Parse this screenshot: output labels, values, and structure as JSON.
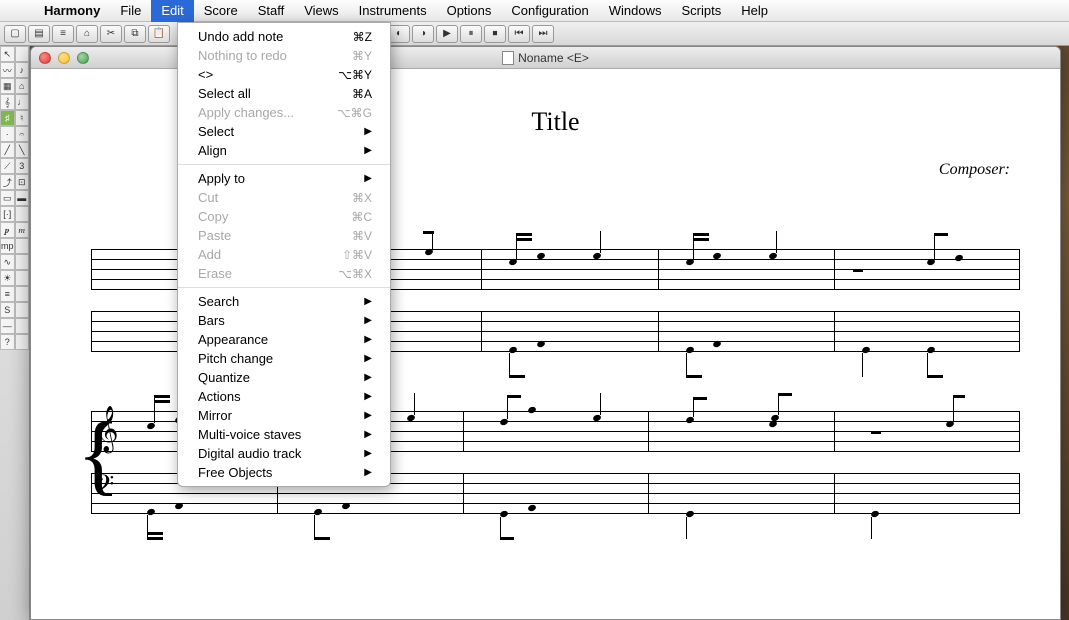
{
  "menubar": {
    "apple": "",
    "items": [
      {
        "label": "Harmony",
        "app": true
      },
      {
        "label": "File"
      },
      {
        "label": "Edit",
        "active": true
      },
      {
        "label": "Score"
      },
      {
        "label": "Staff"
      },
      {
        "label": "Views"
      },
      {
        "label": "Instruments"
      },
      {
        "label": "Options"
      },
      {
        "label": "Configuration"
      },
      {
        "label": "Windows"
      },
      {
        "label": "Scripts"
      },
      {
        "label": "Help"
      }
    ]
  },
  "edit_menu": [
    {
      "label": "Undo add note",
      "shortcut": "⌘Z"
    },
    {
      "label": "Nothing to redo",
      "shortcut": "⌘Y",
      "disabled": true
    },
    {
      "label": "<>",
      "shortcut": "⌥⌘Y"
    },
    {
      "label": "Select all",
      "shortcut": "⌘A"
    },
    {
      "label": "Apply changes...",
      "shortcut": "⌥⌘G",
      "disabled": true
    },
    {
      "label": "Select",
      "submenu": true
    },
    {
      "label": "Align",
      "submenu": true
    },
    {
      "sep": true
    },
    {
      "label": "Apply to",
      "submenu": true
    },
    {
      "label": "Cut",
      "shortcut": "⌘X",
      "disabled": true
    },
    {
      "label": "Copy",
      "shortcut": "⌘C",
      "disabled": true
    },
    {
      "label": "Paste",
      "shortcut": "⌘V",
      "disabled": true
    },
    {
      "label": "Add",
      "shortcut": "⇧⌘V",
      "disabled": true
    },
    {
      "label": "Erase",
      "shortcut": "⌥⌘X",
      "disabled": true
    },
    {
      "sep": true
    },
    {
      "label": "Search",
      "submenu": true
    },
    {
      "label": "Bars",
      "submenu": true
    },
    {
      "label": "Appearance",
      "submenu": true
    },
    {
      "label": "Pitch change",
      "submenu": true
    },
    {
      "label": "Quantize",
      "submenu": true
    },
    {
      "label": "Actions",
      "submenu": true
    },
    {
      "label": "Mirror",
      "submenu": true
    },
    {
      "label": "Multi-voice staves",
      "submenu": true
    },
    {
      "label": "Digital audio track",
      "submenu": true
    },
    {
      "label": "Free Objects",
      "submenu": true
    }
  ],
  "window": {
    "title": "Noname <E>"
  },
  "score": {
    "title": "Title",
    "composer_label": "Composer:"
  },
  "palette_tools": [
    [
      "↖",
      ""
    ],
    [
      "〰",
      "♪"
    ],
    [
      "▦",
      "⌂"
    ],
    [
      "𝄞",
      "♩"
    ],
    [
      "♯",
      "♮"
    ],
    [
      "·",
      "𝄐"
    ],
    [
      "╱",
      "╲"
    ],
    [
      "⟋",
      "3"
    ],
    [
      "⤴",
      "⊡"
    ],
    [
      "▭",
      "▬"
    ],
    [
      "[·]",
      ""
    ],
    [
      "𝆏",
      "𝆐"
    ],
    [
      "mp",
      ""
    ],
    [
      "∿",
      ""
    ],
    [
      "☀",
      ""
    ],
    [
      "≡",
      ""
    ],
    [
      "S",
      ""
    ],
    [
      "—",
      ""
    ],
    [
      "?",
      ""
    ]
  ]
}
